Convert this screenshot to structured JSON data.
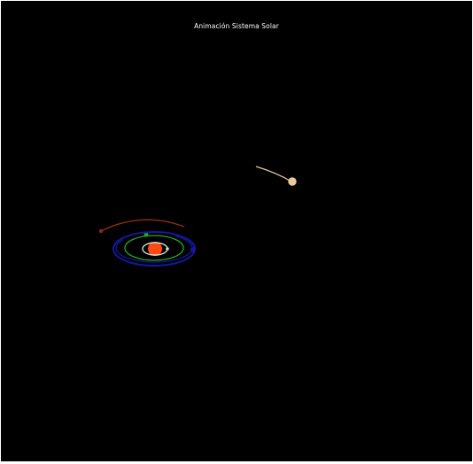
{
  "title": "Animación Sistema Solar",
  "colors": {
    "background": "#000000",
    "sun": "#ff4a0f",
    "orbit_inner": "#d8d8d8",
    "orbit_green": "#22aa22",
    "orbit_blue": "#1616a0",
    "orbit_red": "#8a2a10",
    "comet": "#e9c8a0"
  },
  "bodies": [
    {
      "name": "sun",
      "color": "#ff4a0f"
    },
    {
      "name": "inner-planet",
      "color": "#d8d8d8"
    },
    {
      "name": "green-planet",
      "color": "#22aa22"
    },
    {
      "name": "blue-planet",
      "color": "#1616a0"
    },
    {
      "name": "red-planet",
      "color": "#8a2a10"
    },
    {
      "name": "comet",
      "color": "#e9c8a0"
    }
  ]
}
